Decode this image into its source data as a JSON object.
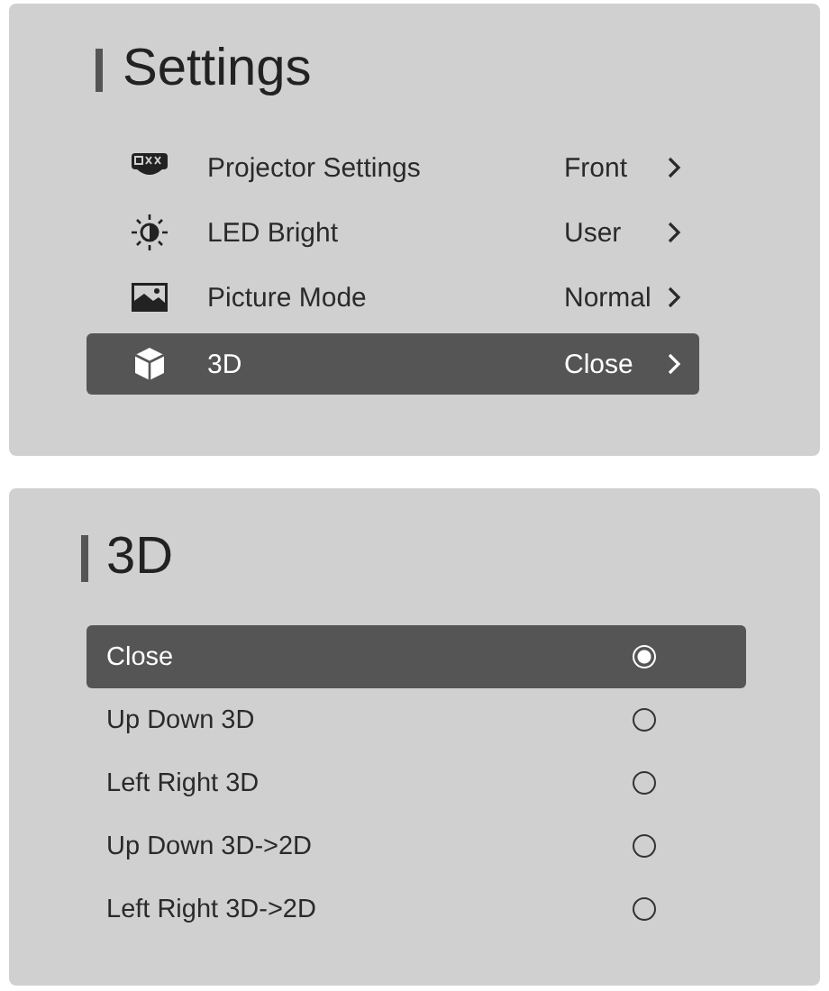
{
  "settings": {
    "title": "Settings",
    "items": [
      {
        "kind": "projector",
        "label": "Projector Settings",
        "value": "Front",
        "selected": false
      },
      {
        "kind": "brightness",
        "label": "LED Bright",
        "value": "User",
        "selected": false
      },
      {
        "kind": "picture",
        "label": "Picture Mode",
        "value": "Normal",
        "selected": false
      },
      {
        "kind": "cube",
        "label": "3D",
        "value": "Close",
        "selected": true
      }
    ]
  },
  "mode_3d": {
    "title": "3D",
    "options": [
      {
        "label": "Close",
        "selected": true
      },
      {
        "label": "Up Down 3D",
        "selected": false
      },
      {
        "label": "Left Right 3D",
        "selected": false
      },
      {
        "label": "Up Down 3D->2D",
        "selected": false
      },
      {
        "label": "Left Right 3D->2D",
        "selected": false
      }
    ]
  }
}
